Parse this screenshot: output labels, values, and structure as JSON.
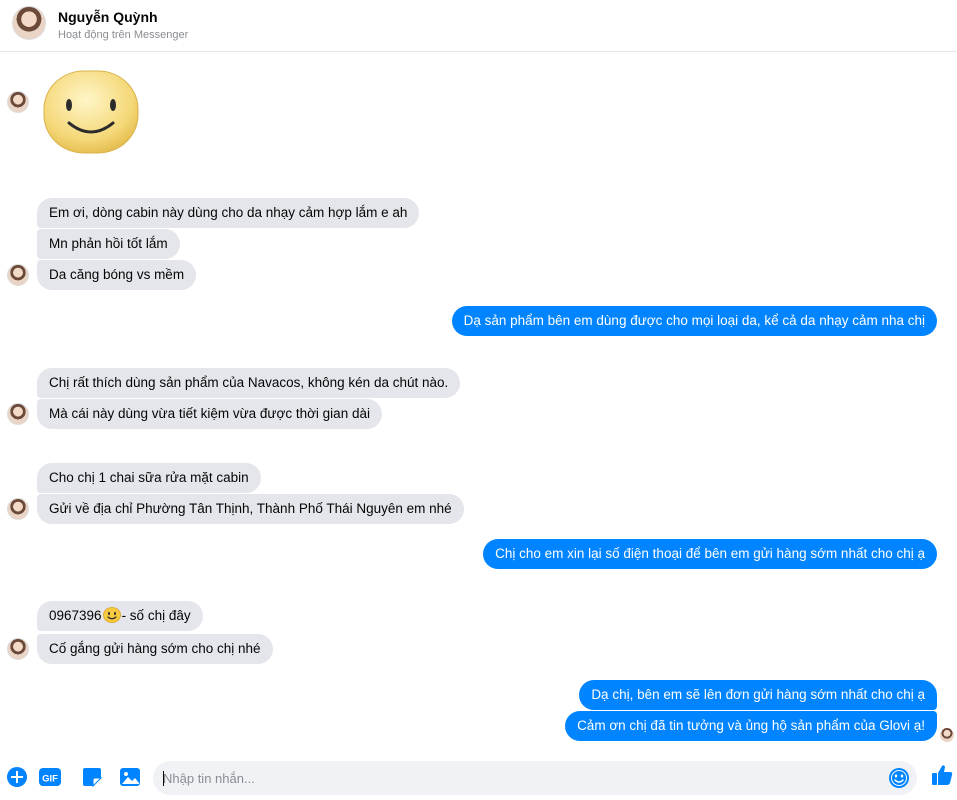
{
  "header": {
    "contact_name": "Nguyễn Quỳnh",
    "status": "Hoạt động trên Messenger"
  },
  "thread": {
    "sticker": "smiley-face-sticker",
    "messages": [
      {
        "from": "in",
        "text": "Em ơi, dòng cabin này dùng cho da nhạy cảm hợp lắm e ah"
      },
      {
        "from": "in",
        "text": "Mn phản hồi tốt lắm"
      },
      {
        "from": "in",
        "text": "Da căng bóng vs mềm"
      },
      {
        "from": "out",
        "text": "Dạ sản phẩm bên em dùng được cho mọi loại da, kể cả da nhạy cảm nha chị"
      },
      {
        "from": "in",
        "text": "Chị rất thích dùng sản phẩm của Navacos, không kén da chút nào."
      },
      {
        "from": "in",
        "text": "Mà cái này dùng vừa tiết kiệm vừa được thời gian dài"
      },
      {
        "from": "in",
        "text": "Cho chị 1 chai sữa rửa mặt cabin"
      },
      {
        "from": "in",
        "text": "Gửi về địa chỉ Phường Tân Thịnh, Thành Phố Thái Nguyên em nhé"
      },
      {
        "from": "out",
        "text": "Chị cho em xin lại số điện thoại để bên em gửi hàng sớm nhất cho chị ạ"
      },
      {
        "from": "in",
        "text_before": "0967396",
        "text_after": "- số chị đây",
        "emoji": "smiley-emoji"
      },
      {
        "from": "in",
        "text": "Cố gắng gửi hàng sớm cho chị nhé"
      },
      {
        "from": "out",
        "text": "Dạ chị, bên em sẽ lên đơn gửi hàng sớm nhất cho chị ạ"
      },
      {
        "from": "out",
        "text": "Cảm ơn chị đã tin tưởng và ủng hộ sản phẩm của Glovi ạ!"
      }
    ]
  },
  "composer": {
    "placeholder": "Nhập tin nhắn...",
    "value": "",
    "tools": [
      "add-icon",
      "gif-icon",
      "sticker-icon",
      "image-icon"
    ],
    "emoji_button": "emoji-icon",
    "like_button": "thumbs-up-icon"
  },
  "colors": {
    "accent": "#0084ff",
    "incoming_bubble": "#e4e6eb",
    "outgoing_text": "#ffffff"
  }
}
